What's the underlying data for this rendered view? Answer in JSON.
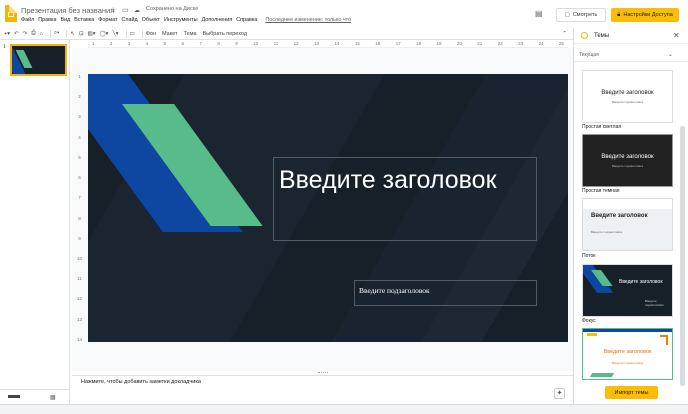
{
  "header": {
    "doc_title": "Презентация без названия",
    "saved_status": "Сохранено на Диске",
    "watch_label": "Смотреть",
    "access_label": "Настройки Доступа"
  },
  "menu": {
    "items": [
      "Файл",
      "Правка",
      "Вид",
      "Вставка",
      "Формат",
      "Слайд",
      "Объект",
      "Инструменты",
      "Дополнения",
      "Справка"
    ],
    "last_edit": "Последнее изменение: только что"
  },
  "toolbar": {
    "background_label": "Фон",
    "layout_label": "Макет",
    "theme_label": "Тема",
    "transition_label": "Выбрать переход"
  },
  "filmstrip": {
    "slide_number": "1"
  },
  "slide": {
    "title_placeholder": "Введите заголовок",
    "subtitle_placeholder": "Введите подзаголовок",
    "background_color": "#172029",
    "accent_blue": "#0d47a1",
    "accent_green": "#57bb8a"
  },
  "rulers": {
    "horizontal": [
      "1",
      "2",
      "3",
      "4",
      "5",
      "6",
      "7",
      "8",
      "9",
      "10",
      "11",
      "12",
      "13",
      "14",
      "15",
      "16",
      "17",
      "18",
      "19",
      "20",
      "21",
      "22",
      "23",
      "24",
      "25"
    ],
    "vertical": [
      "1",
      "2",
      "3",
      "4",
      "5",
      "6",
      "7",
      "8",
      "9",
      "10",
      "11",
      "12",
      "13",
      "14"
    ]
  },
  "notes": {
    "placeholder": "Нажмите, чтобы добавить заметки докладчика"
  },
  "themes_panel": {
    "title": "Темы",
    "current_label": "Текущая",
    "themes": [
      {
        "name": "",
        "card_title": "Введите заголовок",
        "card_sub": "Введите подзаголовок"
      },
      {
        "name": "Простая светлая",
        "card_title": "Введите заголовок",
        "card_sub": "Введите подзаголовок"
      },
      {
        "name": "Простая темная",
        "card_title": "Введите заголовок",
        "card_sub": "Введите подзаголовок"
      },
      {
        "name": "Поток",
        "card_title": "Введите заголовок",
        "card_sub": "Введите подзаголовок"
      },
      {
        "name": "Фокус",
        "card_title": "Введите заголовок",
        "card_sub": "Введите подзаголовок"
      }
    ],
    "import_label": "Импорт темы"
  }
}
